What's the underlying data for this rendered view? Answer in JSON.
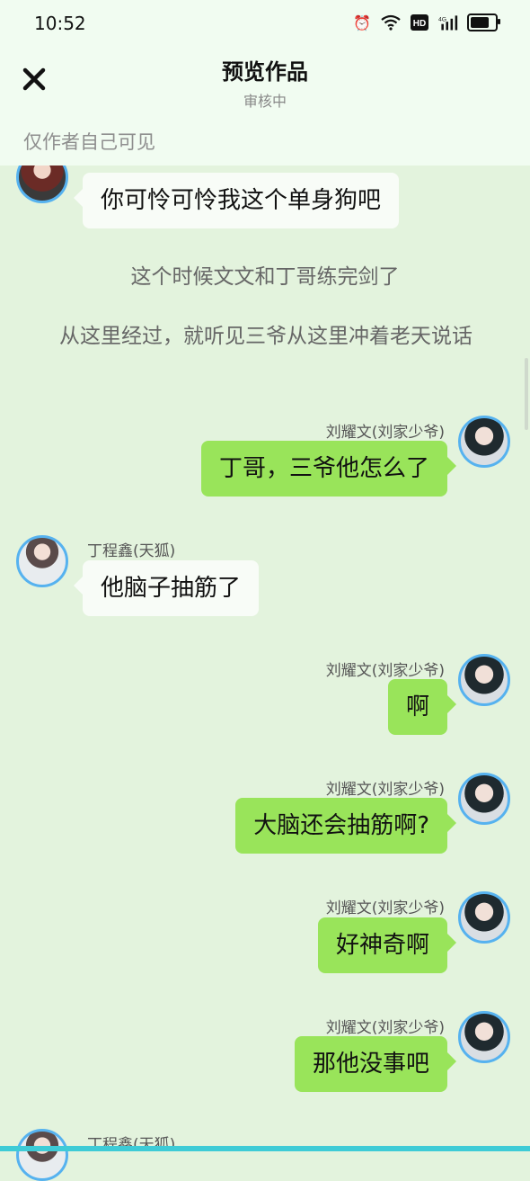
{
  "status": {
    "time": "10:52"
  },
  "header": {
    "title": "预览作品",
    "subtitle": "审核中",
    "privacy_note": "仅作者自己可见"
  },
  "messages": [
    {
      "text": "你可怜可怜我这个单身狗吧"
    },
    {
      "narration": "这个时候文文和丁哥练完剑了"
    },
    {
      "narration": "从这里经过，就听见三爷从这里冲着老天说话"
    },
    {
      "speaker": "刘耀文(刘家少爷)",
      "text": "丁哥，三爷他怎么了"
    },
    {
      "speaker": "丁程鑫(天狐)",
      "text": "他脑子抽筋了"
    },
    {
      "speaker": "刘耀文(刘家少爷)",
      "text": "啊"
    },
    {
      "speaker": "刘耀文(刘家少爷)",
      "text": "大脑还会抽筋啊?"
    },
    {
      "speaker": "刘耀文(刘家少爷)",
      "text": "好神奇啊"
    },
    {
      "speaker": "刘耀文(刘家少爷)",
      "text": "那他没事吧"
    },
    {
      "speaker": "丁程鑫(天狐)"
    }
  ]
}
